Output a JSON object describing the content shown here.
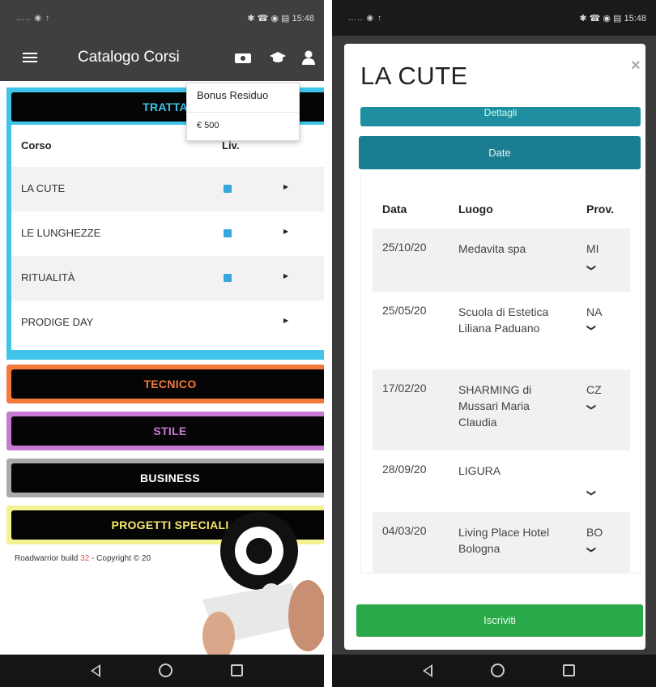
{
  "status_bar": {
    "left": "…‥ ◉ ↑",
    "right": "✱ ☎ ◉ ▤ 15:48"
  },
  "left_screen": {
    "nav": {
      "title": "Catalogo Corsi"
    },
    "bonus_tooltip": {
      "title": "Bonus Residuo",
      "value": "€ 500"
    },
    "categories": [
      {
        "label": "TRATTAMENTI",
        "color": "#40c4ea"
      },
      {
        "label": "TECNICO",
        "color": "#f47a3c"
      },
      {
        "label": "STILE",
        "color": "#c67ad2"
      },
      {
        "label": "BUSINESS",
        "color": "#aaaaaa"
      },
      {
        "label": "PROGETTI SPECIALI",
        "color": "#f5f291"
      }
    ],
    "trattamenti_label_visible": "TRATTAM",
    "table": {
      "col_course": "Corso",
      "col_level": "Liv.",
      "rows": [
        {
          "name": "LA CUTE",
          "has_level": true
        },
        {
          "name": "LE LUNGHEZZE",
          "has_level": true
        },
        {
          "name": "RITUALITÀ",
          "has_level": true
        },
        {
          "name": "PRODIGE DAY",
          "has_level": false
        }
      ]
    },
    "footer": {
      "prefix": "Roadwarrior build ",
      "build": "32",
      "suffix": " - Copyright © 20"
    }
  },
  "right_screen": {
    "modal_title": "LA CUTE",
    "close_symbol": "×",
    "dettagli_label": "Dettagli",
    "date_label": "Date",
    "table": {
      "col_date": "Data",
      "col_place": "Luogo",
      "col_prov": "Prov.",
      "rows": [
        {
          "date": "25/10/20",
          "place": "Medavita spa",
          "prov": "MI"
        },
        {
          "date": "25/05/20",
          "place": "Scuola di Estetica Liliana Paduano",
          "prov": "NA"
        },
        {
          "date": "17/02/20",
          "place": "SHARMING di Mussari Maria Claudia",
          "prov": "CZ"
        },
        {
          "date": "28/09/20",
          "place": "LIGURA",
          "prov": ""
        },
        {
          "date": "04/03/20",
          "place": "Living Place Hotel Bologna",
          "prov": "BO"
        }
      ]
    },
    "submit_label": "Iscriviti"
  },
  "colors": {
    "brand_blue": "#40c4ea",
    "date_teal": "#1b7d91",
    "submit_green": "#29a94a",
    "level_badge": "#35a8e0"
  },
  "icons": [
    "menu-icon",
    "bonus-icon",
    "graduation-cap-icon",
    "user-icon",
    "close-icon",
    "chevron-down-icon",
    "caret-right-icon",
    "back-icon",
    "home-icon",
    "recent-apps-icon"
  ]
}
